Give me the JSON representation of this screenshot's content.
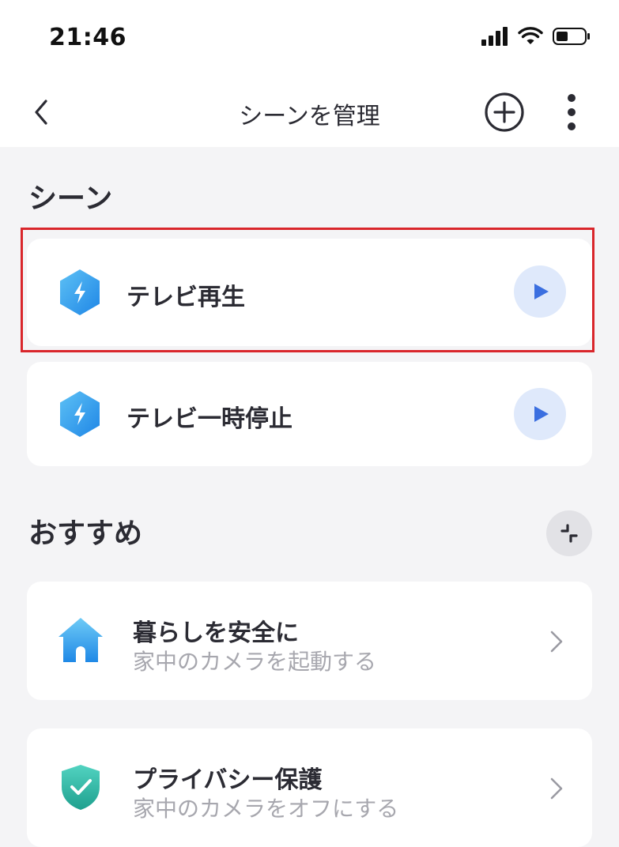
{
  "status_bar": {
    "time": "21:46"
  },
  "nav": {
    "title": "シーンを管理"
  },
  "scenes_section": {
    "title": "シーン",
    "items": [
      {
        "label": "テレビ再生"
      },
      {
        "label": "テレビ一時停止"
      }
    ]
  },
  "recommend_section": {
    "title": "おすすめ",
    "items": [
      {
        "title": "暮らしを安全に",
        "subtitle": "家中のカメラを起動する"
      },
      {
        "title": "プライバシー保護",
        "subtitle": "家中のカメラをオフにする"
      }
    ]
  },
  "colors": {
    "highlight_border": "#d9262b",
    "play_bg": "#dfe9fb",
    "play_icon": "#3b6fe0",
    "accent_blue": "#2a8fe8",
    "accent_green": "#2fb8a3"
  },
  "icons": {
    "back": "chevron-left-icon",
    "add": "plus-circle-icon",
    "more": "more-vertical-icon",
    "scene": "lightning-hexagon-icon",
    "play": "play-icon",
    "collapse": "collapse-icon",
    "home": "home-icon",
    "shield": "shield-check-icon",
    "chevron": "chevron-right-icon"
  }
}
